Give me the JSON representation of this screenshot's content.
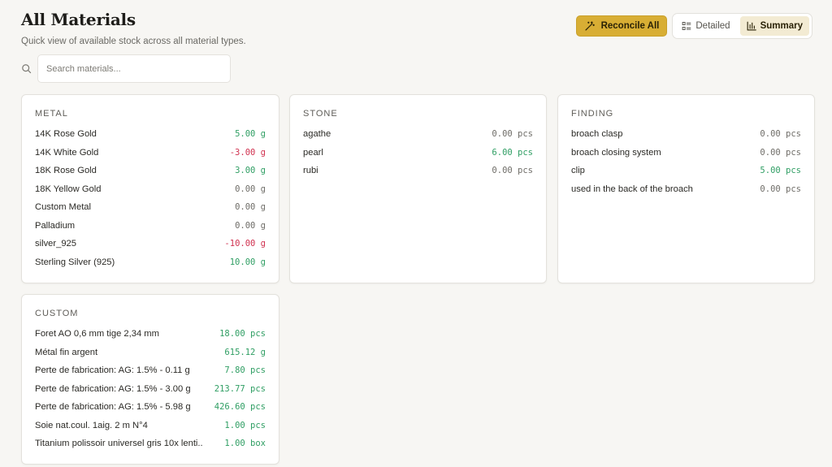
{
  "header": {
    "title": "All Materials",
    "subtitle": "Quick view of available stock across all material types."
  },
  "actions": {
    "reconcile_label": "Reconcile All",
    "detailed_label": "Detailed",
    "summary_label": "Summary",
    "active_view": "Summary"
  },
  "search": {
    "placeholder": "Search materials...",
    "value": ""
  },
  "colors": {
    "accent": "#d8ae34",
    "positive": "#2f9e63",
    "negative": "#d0314f",
    "neutral": "#6f6d68"
  },
  "icons": {
    "reconcile": "wand-icon",
    "detailed": "list-icon",
    "summary": "bar-chart-icon",
    "search": "search-icon"
  },
  "cards": {
    "metal": {
      "heading": "METAL",
      "items": [
        {
          "name": "14K Rose Gold",
          "qty": "5.00 g",
          "sign": "pos"
        },
        {
          "name": "14K White Gold",
          "qty": "-3.00 g",
          "sign": "neg"
        },
        {
          "name": "18K Rose Gold",
          "qty": "3.00 g",
          "sign": "pos"
        },
        {
          "name": "18K Yellow Gold",
          "qty": "0.00 g",
          "sign": "zero"
        },
        {
          "name": "Custom Metal",
          "qty": "0.00 g",
          "sign": "zero"
        },
        {
          "name": "Palladium",
          "qty": "0.00 g",
          "sign": "zero"
        },
        {
          "name": "silver_925",
          "qty": "-10.00 g",
          "sign": "neg"
        },
        {
          "name": "Sterling Silver (925)",
          "qty": "10.00 g",
          "sign": "pos"
        }
      ]
    },
    "stone": {
      "heading": "STONE",
      "items": [
        {
          "name": "agathe",
          "qty": "0.00 pcs",
          "sign": "zero"
        },
        {
          "name": "pearl",
          "qty": "6.00 pcs",
          "sign": "pos"
        },
        {
          "name": "rubi",
          "qty": "0.00 pcs",
          "sign": "zero"
        }
      ]
    },
    "finding": {
      "heading": "FINDING",
      "items": [
        {
          "name": "broach clasp",
          "qty": "0.00 pcs",
          "sign": "zero"
        },
        {
          "name": "broach closing system",
          "qty": "0.00 pcs",
          "sign": "zero"
        },
        {
          "name": "clip",
          "qty": "5.00 pcs",
          "sign": "pos"
        },
        {
          "name": "used in the back of the broach",
          "qty": "0.00 pcs",
          "sign": "zero"
        }
      ]
    },
    "custom": {
      "heading": "CUSTOM",
      "items": [
        {
          "name": "Foret AO 0,6 mm tige 2,34 mm",
          "qty": "18.00 pcs",
          "sign": "pos"
        },
        {
          "name": "Métal fin argent",
          "qty": "615.12 g",
          "sign": "pos"
        },
        {
          "name": "Perte de fabrication: AG: 1.5% - 0.11 g",
          "qty": "7.80 pcs",
          "sign": "pos"
        },
        {
          "name": "Perte de fabrication: AG: 1.5% - 3.00 g",
          "qty": "213.77 pcs",
          "sign": "pos"
        },
        {
          "name": "Perte de fabrication: AG: 1.5% - 5.98 g",
          "qty": "426.60 pcs",
          "sign": "pos"
        },
        {
          "name": "Soie nat.coul. 1aig. 2 m N°4",
          "qty": "1.00 pcs",
          "sign": "pos"
        },
        {
          "name": "Titanium polissoir universel gris 10x lenti..",
          "qty": "1.00 box",
          "sign": "pos"
        }
      ]
    }
  }
}
